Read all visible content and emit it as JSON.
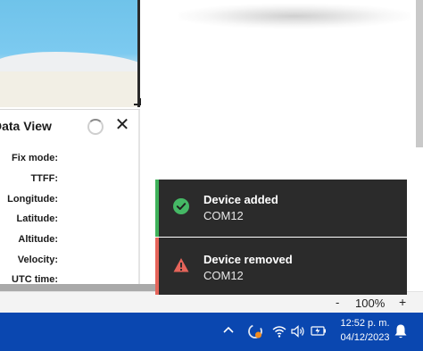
{
  "data_view": {
    "title": "Data View",
    "fields": [
      {
        "label": "Fix mode:",
        "value": ""
      },
      {
        "label": "TTFF:",
        "value": ""
      },
      {
        "label": "Longitude:",
        "value": ""
      },
      {
        "label": "Latitude:",
        "value": ""
      },
      {
        "label": "Altitude:",
        "value": ""
      },
      {
        "label": "Velocity:",
        "value": ""
      },
      {
        "label": "UTC time:",
        "value": ""
      }
    ],
    "close_icon": "close-icon",
    "spinner_icon": "loading-spinner-icon"
  },
  "toasts": [
    {
      "title": "Device added",
      "subtitle": "COM12",
      "accent": "#3fb25a",
      "icon": "check-circle-icon"
    },
    {
      "title": "Device removed",
      "subtitle": "COM12",
      "accent": "#e5645a",
      "icon": "warning-triangle-icon"
    }
  ],
  "statusbar": {
    "zoom_minus": "-",
    "zoom_level": "100%",
    "zoom_plus": "+"
  },
  "taskbar": {
    "time": "12:52 p. m.",
    "date": "04/12/2023",
    "background": "#0a47b0"
  }
}
